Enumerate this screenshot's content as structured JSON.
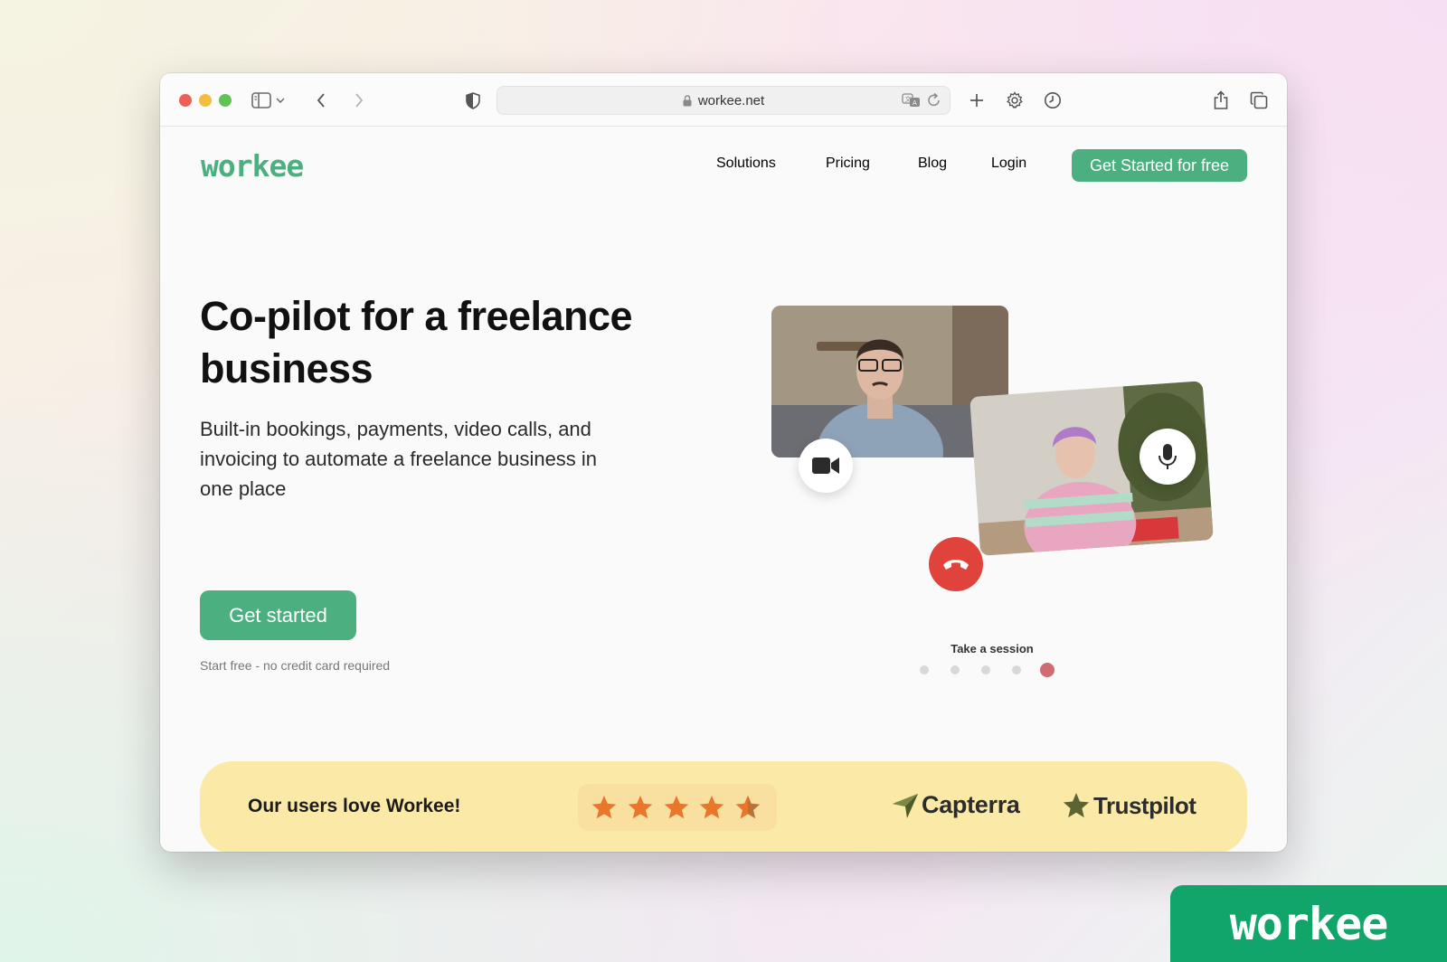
{
  "browser": {
    "url": "workee.net",
    "icons": [
      "sidebar-icon",
      "chevron-down-icon",
      "back-icon",
      "forward-icon",
      "shield-icon",
      "lock-icon",
      "translate-icon",
      "reload-icon",
      "new-tab-icon",
      "settings-icon",
      "history-icon",
      "share-icon",
      "tabs-overview-icon"
    ]
  },
  "site": {
    "logo": "workee",
    "nav": [
      "Solutions",
      "Pricing",
      "Blog",
      "Login"
    ],
    "nav_cta": "Get Started for free",
    "hero": {
      "title": "Co-pilot for a freelance business",
      "subtitle": "Built-in bookings, payments, video calls, and invoicing to automate a freelance business in one place",
      "cta": "Get started",
      "note": "Start free - no credit card required"
    },
    "carousel": {
      "caption": "Take a session",
      "slide_count": 5,
      "active_index": 4,
      "icons": [
        "video-camera-icon",
        "microphone-icon",
        "hang-up-icon"
      ]
    },
    "reviews": {
      "text": "Our users love Workee!",
      "rating_stars": 4.5,
      "sources": [
        "Capterra",
        "Trustpilot"
      ]
    }
  },
  "watermark": "workee",
  "colors": {
    "brand_green": "#4caf80",
    "corner_green": "#11a56a",
    "banner_yellow": "#fbeaa7",
    "star_orange": "#e9762b",
    "hangup_red": "#e0433c",
    "active_dot": "#d26a74"
  }
}
